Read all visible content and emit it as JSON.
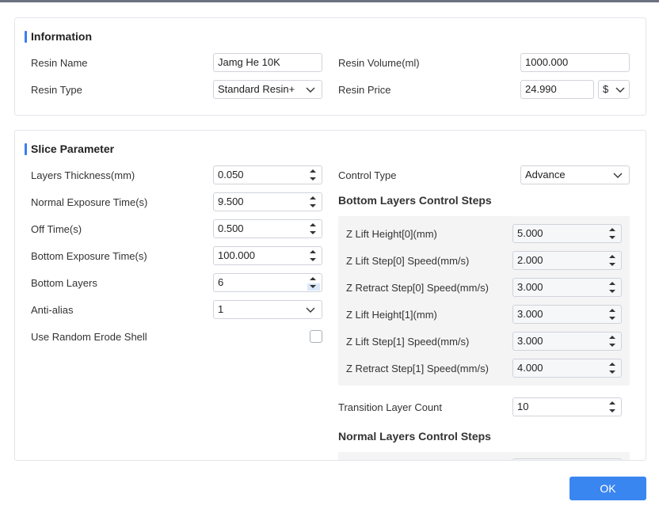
{
  "information": {
    "title": "Information",
    "resin_name_label": "Resin Name",
    "resin_name_value": "Jamg He 10K",
    "resin_type_label": "Resin Type",
    "resin_type_value": "Standard Resin+",
    "resin_volume_label": "Resin Volume(ml)",
    "resin_volume_value": "1000.000",
    "resin_price_label": "Resin Price",
    "resin_price_value": "24.990",
    "currency_value": "$"
  },
  "slice": {
    "title": "Slice Parameter",
    "left": [
      {
        "label": "Layers Thickness(mm)",
        "value": "0.050"
      },
      {
        "label": "Normal Exposure Time(s)",
        "value": "9.500"
      },
      {
        "label": "Off Time(s)",
        "value": "0.500"
      },
      {
        "label": "Bottom Exposure Time(s)",
        "value": "100.000"
      },
      {
        "label": "Bottom Layers",
        "value": "6"
      },
      {
        "label": "Anti-alias",
        "value": "1"
      },
      {
        "label": "Use Random Erode Shell"
      }
    ],
    "control_type_label": "Control Type",
    "control_type_value": "Advance",
    "bottom_steps_title": "Bottom Layers Control Steps",
    "bottom_steps": [
      {
        "label": "Z Lift Height[0](mm)",
        "value": "5.000"
      },
      {
        "label": "Z Lift Step[0] Speed(mm/s)",
        "value": "2.000"
      },
      {
        "label": "Z Retract Step[0] Speed(mm/s)",
        "value": "3.000"
      },
      {
        "label": "Z Lift Height[1](mm)",
        "value": "3.000"
      },
      {
        "label": "Z Lift Step[1] Speed(mm/s)",
        "value": "3.000"
      },
      {
        "label": "Z Retract Step[1] Speed(mm/s)",
        "value": "4.000"
      }
    ],
    "transition_label": "Transition Layer Count",
    "transition_value": "10",
    "normal_steps_title": "Normal Layers Control Steps"
  },
  "footer": {
    "ok_label": "OK"
  },
  "colors": {
    "accent": "#3a86f0",
    "section_marker": "#3a7df0"
  }
}
